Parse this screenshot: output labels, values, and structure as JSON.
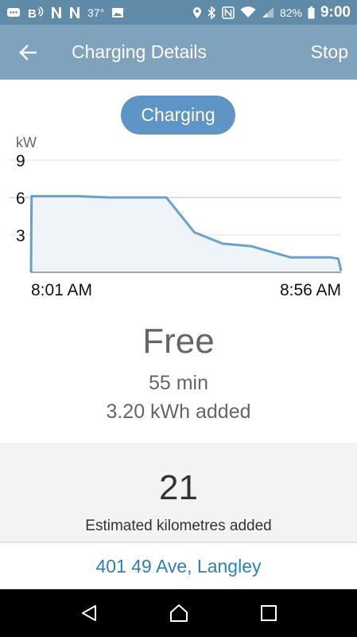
{
  "status_bar": {
    "temperature": "37°",
    "battery": "82%",
    "time": "9:00"
  },
  "app_bar": {
    "title": "Charging Details",
    "stop_label": "Stop"
  },
  "status_pill": "Charging",
  "chart_data": {
    "type": "area",
    "ylabel": "kW",
    "yticks": [
      "9",
      "6",
      "3"
    ],
    "ylim": [
      0,
      9
    ],
    "x_start_label": "8:01 AM",
    "x_end_label": "8:56 AM",
    "x_minutes": [
      0,
      0.1,
      8,
      14,
      20,
      24,
      29,
      34,
      39,
      46,
      53,
      54.5,
      55
    ],
    "y_kw": [
      0,
      6.1,
      6.1,
      6.0,
      6.0,
      6.0,
      3.2,
      2.3,
      2.1,
      1.2,
      1.2,
      1.1,
      0.1
    ],
    "line_color": "#6aa0ce",
    "fill_color": "#eff4f9",
    "grid": true
  },
  "summary": {
    "cost": "Free",
    "duration": "55 min",
    "energy": "3.20 kWh added"
  },
  "estimate": {
    "value": "21",
    "label": "Estimated kilometres added"
  },
  "address": "401 49 Ave, Langley",
  "colors": {
    "status_bar": "#5f8aa8",
    "app_bar": "#7fa3bd",
    "pill": "#5e95c6",
    "link": "#2e7fb8"
  }
}
